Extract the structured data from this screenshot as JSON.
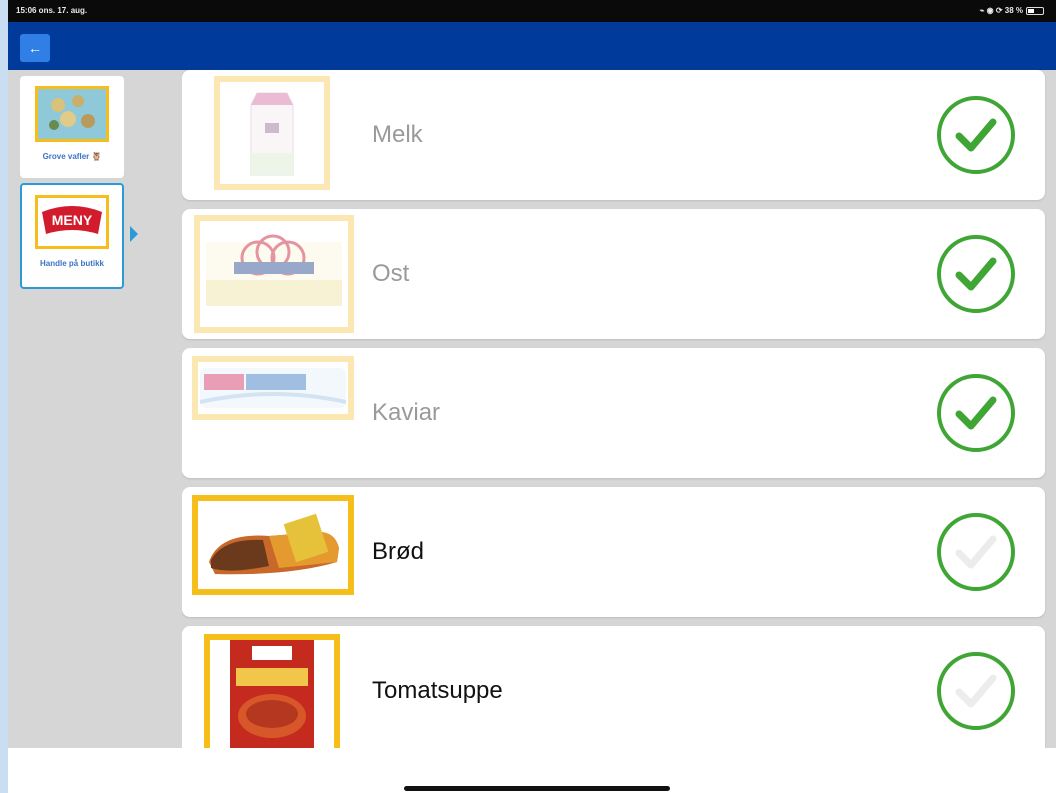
{
  "status_bar": {
    "time": "15:06  ons. 17. aug.",
    "indicators": "⌁ ◉ ⟳ 38 %"
  },
  "header": {
    "back_icon": "arrow-left-icon",
    "back_glyph": "←"
  },
  "sidebar": {
    "items": [
      {
        "label": "Grove vafler 🦉",
        "icon": "waffles-icon",
        "selected": false
      },
      {
        "label": "Handle på butikk",
        "icon": "meny-logo",
        "logo_text": "MENY",
        "selected": true
      }
    ]
  },
  "list": {
    "items": [
      {
        "label": "Melk",
        "image": "milk-carton-icon",
        "checked": true
      },
      {
        "label": "Ost",
        "image": "cheese-icon",
        "checked": true
      },
      {
        "label": "Kaviar",
        "image": "caviar-tube-icon",
        "checked": true
      },
      {
        "label": "Brød",
        "image": "bread-icon",
        "checked": false
      },
      {
        "label": "Tomatsuppe",
        "image": "tomato-soup-icon",
        "checked": false
      }
    ]
  },
  "colors": {
    "header": "#003a9a",
    "accent": "#2f7fe6",
    "check_green": "#3fa535",
    "thumb_border": "#f5be1b"
  }
}
